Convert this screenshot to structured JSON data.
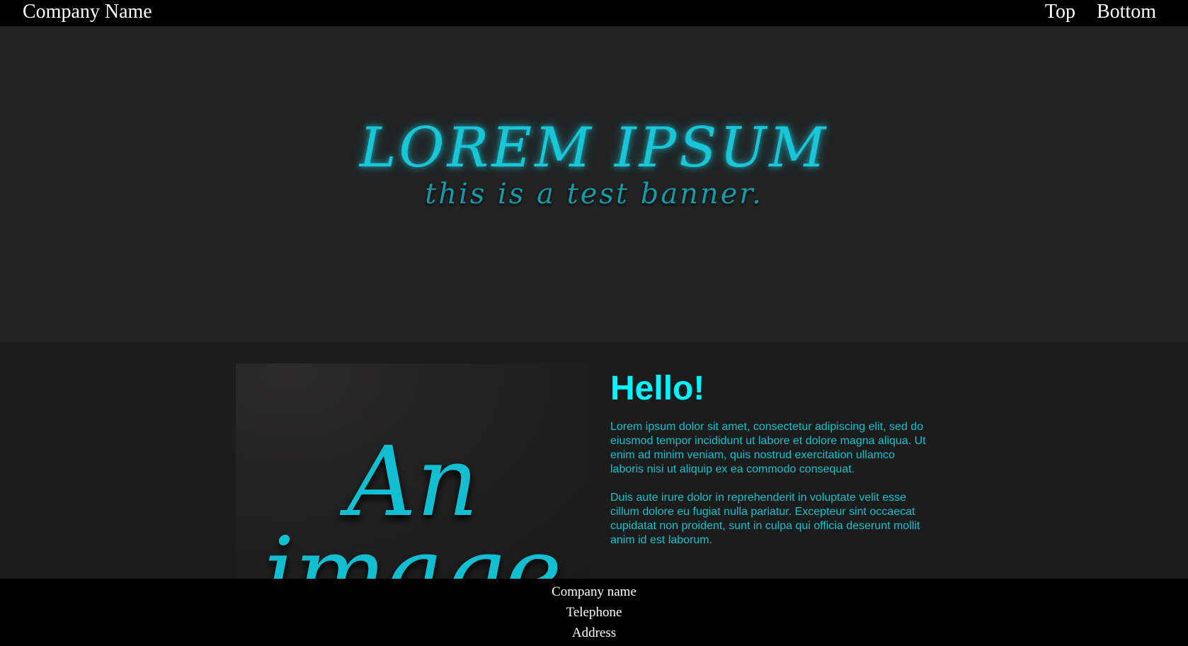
{
  "header": {
    "brand": "Company Name",
    "nav": [
      {
        "label": "Top"
      },
      {
        "label": "Bottom"
      }
    ]
  },
  "hero": {
    "title": "LOREM IPSUM",
    "subtitle": "this is a test banner."
  },
  "content": {
    "image_text": {
      "line1": "An",
      "line2": "image"
    },
    "heading": "Hello!",
    "paragraphs": [
      "Lorem ipsum dolor sit amet, consectetur adipiscing elit, sed do eiusmod tempor incididunt ut labore et dolore magna aliqua. Ut enim ad minim veniam, quis nostrud exercitation ullamco laboris nisi ut aliquip ex ea commodo consequat.",
      "Duis aute irure dolor in reprehenderit in voluptate velit esse cillum dolore eu fugiat nulla pariatur. Excepteur sint occaecat cupidatat non proident, sunt in culpa qui officia deserunt mollit anim id est laborum."
    ]
  },
  "footer": {
    "company": "Company name",
    "telephone": "Telephone",
    "address": "Address"
  },
  "colors": {
    "accent": "#19c6d8",
    "heading": "#00f6ff",
    "body_text": "#18c0cc",
    "bars": "#000000",
    "hero_bg": "#222223",
    "content_bg": "#1c1c1d"
  }
}
